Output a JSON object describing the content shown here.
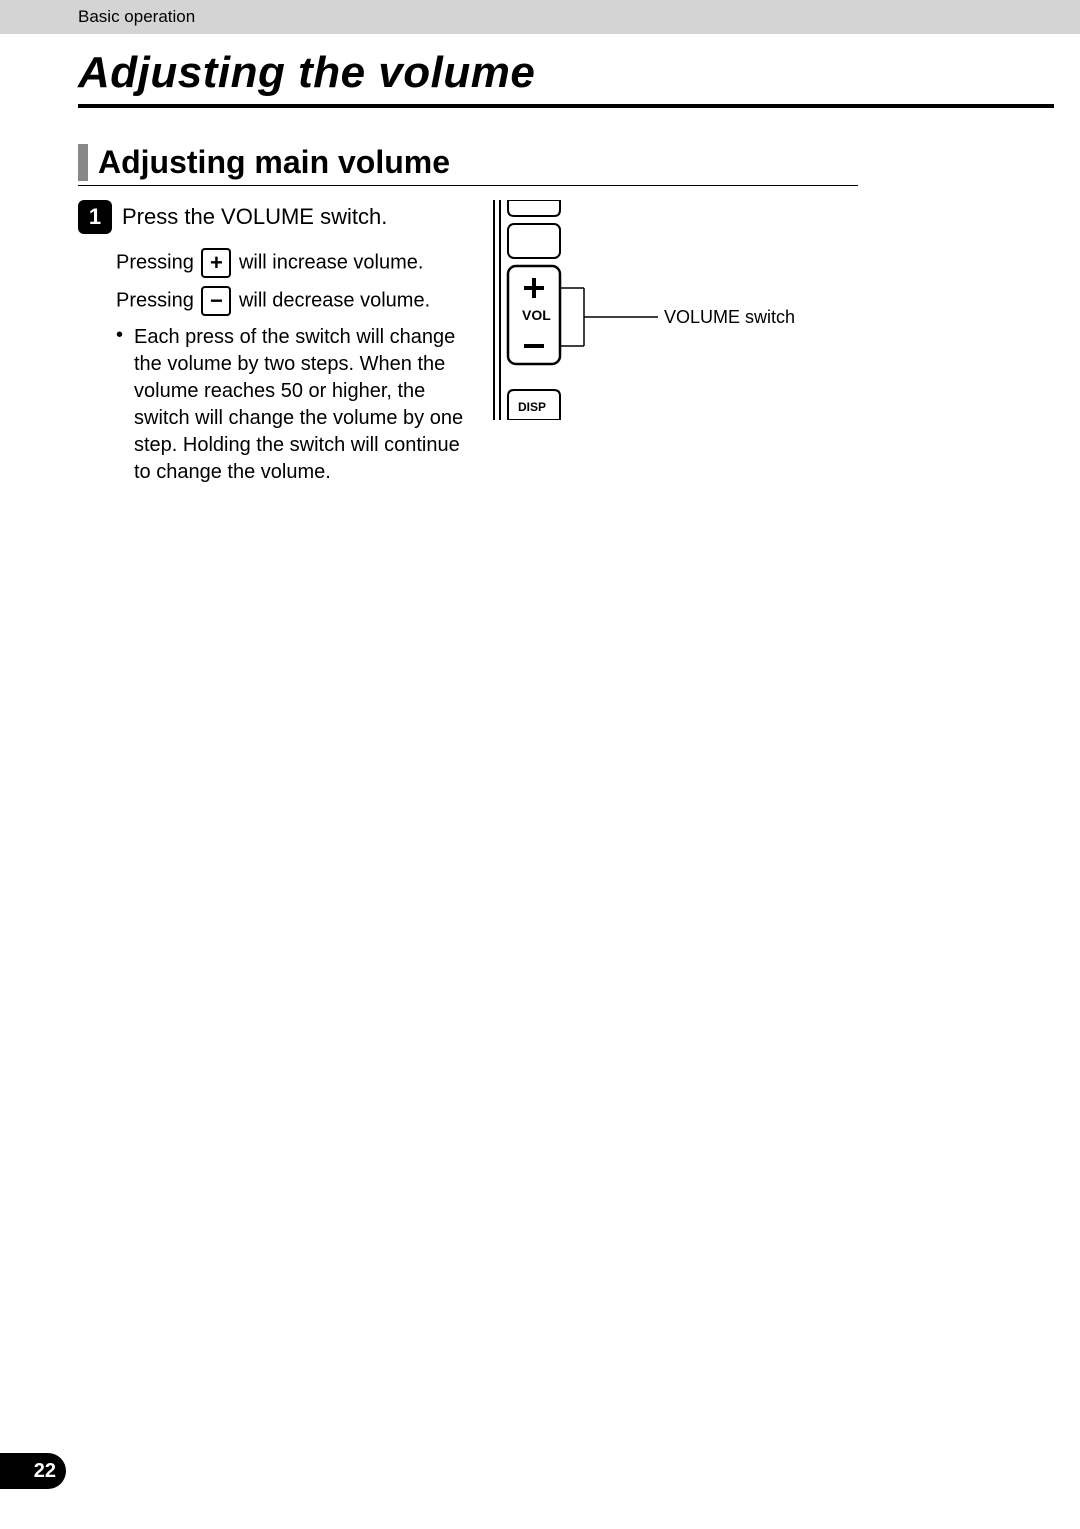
{
  "breadcrumb": "Basic operation",
  "title": "Adjusting the volume",
  "subsection": "Adjusting main volume",
  "step": {
    "num": "1",
    "title": "Press the VOLUME switch."
  },
  "lines": {
    "inc_pre": "Pressing ",
    "inc_post": " will increase volume.",
    "dec_pre": "Pressing ",
    "dec_post": " will decrease volume."
  },
  "icons": {
    "plus": "+",
    "minus": "−"
  },
  "bullet": "Each press of the switch will change the volume by two steps.  When the volume reaches 50 or higher, the switch will change the volume by one step.  Holding the switch will continue to change the volume.",
  "diagram": {
    "vol_label": "VOL",
    "disp_label": "DISP",
    "callout": "VOLUME switch"
  },
  "page_number": "22"
}
